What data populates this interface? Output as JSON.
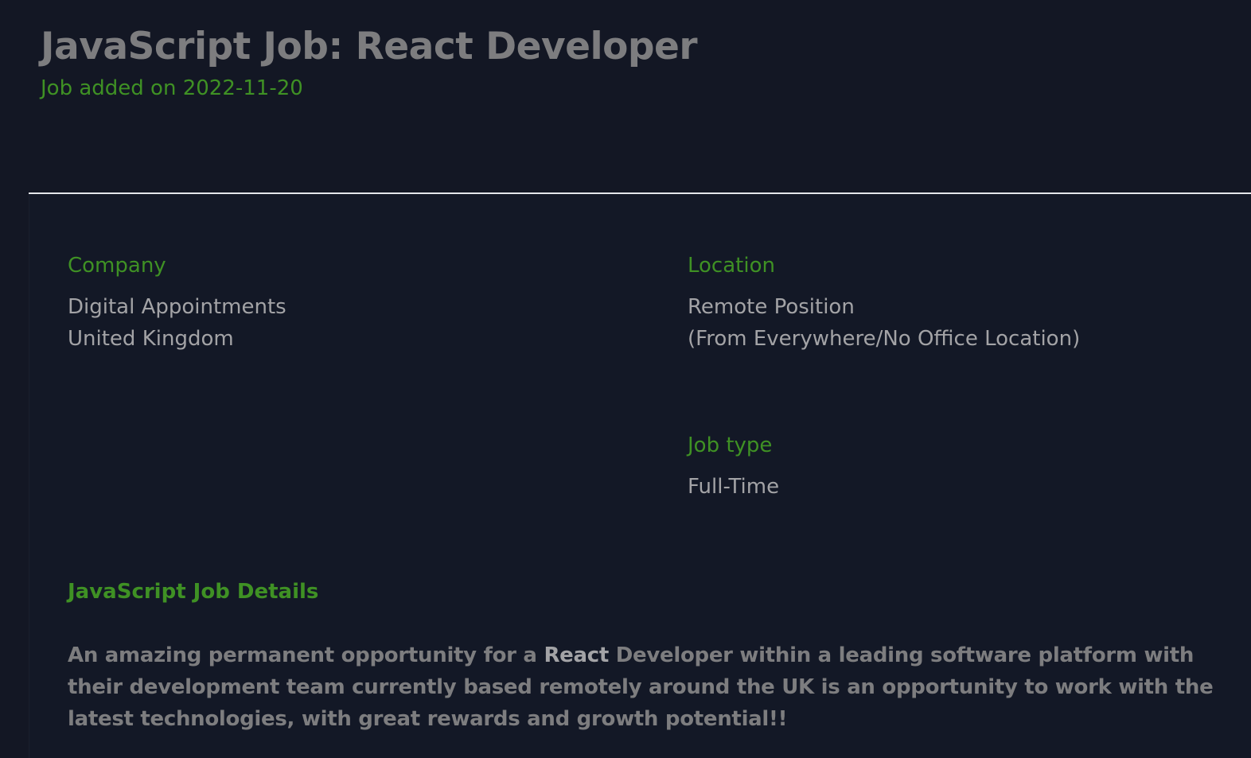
{
  "header": {
    "title": "JavaScript Job: React Developer",
    "subtitle": "Job added on 2022-11-20"
  },
  "company": {
    "label": "Company",
    "name": "Digital Appointments",
    "country": "United Kingdom"
  },
  "location": {
    "label": "Location",
    "line1": "Remote Position",
    "line2": "(From Everywhere/No Office Location)"
  },
  "job_type": {
    "label": "Job type",
    "value": "Full-Time"
  },
  "details": {
    "heading": "JavaScript Job Details",
    "intro_before": "An amazing permanent opportunity for a ",
    "intro_highlight": "React",
    "intro_after": " Developer within a leading software platform with their development team currently based remotely around the UK is an opportunity to work with the latest technologies, with great rewards and growth potential!!"
  },
  "colors": {
    "background": "#131724",
    "accent_green": "#3f9124",
    "title_gray": "#7d7d7f",
    "text_gray": "#a3a3a6",
    "divider": "#e4e6ea"
  }
}
